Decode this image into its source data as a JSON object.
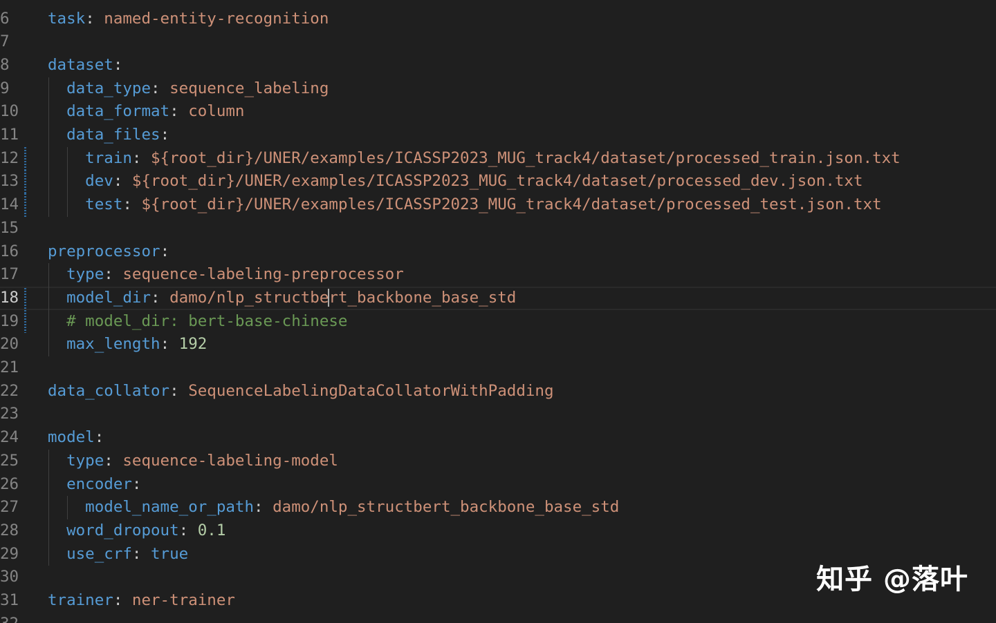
{
  "editor": {
    "language": "yaml",
    "active_line": "18",
    "lines": [
      {
        "num": "6",
        "tokens": [
          {
            "t": "task",
            "c": "k"
          },
          {
            "t": ": ",
            "c": "p"
          },
          {
            "t": "named-entity-recognition",
            "c": "s"
          }
        ]
      },
      {
        "num": "7",
        "tokens": []
      },
      {
        "num": "8",
        "tokens": [
          {
            "t": "dataset",
            "c": "k"
          },
          {
            "t": ":",
            "c": "p"
          }
        ]
      },
      {
        "num": "9",
        "tokens": [
          {
            "t": "  data_type",
            "c": "k"
          },
          {
            "t": ": ",
            "c": "p"
          },
          {
            "t": "sequence_labeling",
            "c": "s"
          }
        ]
      },
      {
        "num": "10",
        "tokens": [
          {
            "t": "  data_format",
            "c": "k"
          },
          {
            "t": ": ",
            "c": "p"
          },
          {
            "t": "column",
            "c": "s"
          }
        ]
      },
      {
        "num": "11",
        "tokens": [
          {
            "t": "  data_files",
            "c": "k"
          },
          {
            "t": ":",
            "c": "p"
          }
        ]
      },
      {
        "num": "12",
        "tokens": [
          {
            "t": "    train",
            "c": "k"
          },
          {
            "t": ": ",
            "c": "p"
          },
          {
            "t": "${root_dir}/UNER/examples/ICASSP2023_MUG_track4/dataset/processed_train.json.txt",
            "c": "s"
          }
        ]
      },
      {
        "num": "13",
        "tokens": [
          {
            "t": "    dev",
            "c": "k"
          },
          {
            "t": ": ",
            "c": "p"
          },
          {
            "t": "${root_dir}/UNER/examples/ICASSP2023_MUG_track4/dataset/processed_dev.json.txt",
            "c": "s"
          }
        ]
      },
      {
        "num": "14",
        "tokens": [
          {
            "t": "    test",
            "c": "k"
          },
          {
            "t": ": ",
            "c": "p"
          },
          {
            "t": "${root_dir}/UNER/examples/ICASSP2023_MUG_track4/dataset/processed_test.json.txt",
            "c": "s"
          }
        ]
      },
      {
        "num": "15",
        "tokens": []
      },
      {
        "num": "16",
        "tokens": [
          {
            "t": "preprocessor",
            "c": "k"
          },
          {
            "t": ":",
            "c": "p"
          }
        ]
      },
      {
        "num": "17",
        "tokens": [
          {
            "t": "  type",
            "c": "k"
          },
          {
            "t": ": ",
            "c": "p"
          },
          {
            "t": "sequence-labeling-preprocessor",
            "c": "s"
          }
        ]
      },
      {
        "num": "18",
        "tokens": [
          {
            "t": "  model_dir",
            "c": "k"
          },
          {
            "t": ": ",
            "c": "p"
          },
          {
            "t": "damo/nlp_structbe",
            "c": "s"
          },
          {
            "t": "",
            "c": "cursor"
          },
          {
            "t": "rt_backbone_base_std",
            "c": "s"
          }
        ]
      },
      {
        "num": "19",
        "tokens": [
          {
            "t": "  # model_dir: bert-base-chinese",
            "c": "c"
          }
        ]
      },
      {
        "num": "20",
        "tokens": [
          {
            "t": "  max_length",
            "c": "k"
          },
          {
            "t": ": ",
            "c": "p"
          },
          {
            "t": "192",
            "c": "n"
          }
        ]
      },
      {
        "num": "21",
        "tokens": []
      },
      {
        "num": "22",
        "tokens": [
          {
            "t": "data_collator",
            "c": "k"
          },
          {
            "t": ": ",
            "c": "p"
          },
          {
            "t": "SequenceLabelingDataCollatorWithPadding",
            "c": "s"
          }
        ]
      },
      {
        "num": "23",
        "tokens": []
      },
      {
        "num": "24",
        "tokens": [
          {
            "t": "model",
            "c": "k"
          },
          {
            "t": ":",
            "c": "p"
          }
        ]
      },
      {
        "num": "25",
        "tokens": [
          {
            "t": "  type",
            "c": "k"
          },
          {
            "t": ": ",
            "c": "p"
          },
          {
            "t": "sequence-labeling-model",
            "c": "s"
          }
        ]
      },
      {
        "num": "26",
        "tokens": [
          {
            "t": "  encoder",
            "c": "k"
          },
          {
            "t": ":",
            "c": "p"
          }
        ]
      },
      {
        "num": "27",
        "tokens": [
          {
            "t": "    model_name_or_path",
            "c": "k"
          },
          {
            "t": ": ",
            "c": "p"
          },
          {
            "t": "damo/nlp_structbert_backbone_base_std",
            "c": "s"
          }
        ]
      },
      {
        "num": "28",
        "tokens": [
          {
            "t": "  word_dropout",
            "c": "k"
          },
          {
            "t": ": ",
            "c": "p"
          },
          {
            "t": "0.1",
            "c": "n"
          }
        ]
      },
      {
        "num": "29",
        "tokens": [
          {
            "t": "  use_crf",
            "c": "k"
          },
          {
            "t": ": ",
            "c": "p"
          },
          {
            "t": "true",
            "c": "b"
          }
        ]
      },
      {
        "num": "30",
        "tokens": []
      },
      {
        "num": "31",
        "tokens": [
          {
            "t": "trainer",
            "c": "k"
          },
          {
            "t": ": ",
            "c": "p"
          },
          {
            "t": "ner-trainer",
            "c": "s"
          }
        ]
      },
      {
        "num": "32",
        "tokens": []
      }
    ],
    "indent_guides": [
      {
        "from": "9",
        "to": "14",
        "level": 1
      },
      {
        "from": "12",
        "to": "14",
        "level": 2
      },
      {
        "from": "17",
        "to": "20",
        "level": 1
      },
      {
        "from": "25",
        "to": "29",
        "level": 1
      },
      {
        "from": "27",
        "to": "27",
        "level": 2
      }
    ],
    "modified_lines": [
      "12",
      "13",
      "14",
      "18",
      "19"
    ]
  },
  "watermark": {
    "text": "知乎 @落叶"
  },
  "colors": {
    "background": "#1f1f1f",
    "key": "#569cd6",
    "string": "#ce9178",
    "number": "#b5cea8",
    "comment": "#6a9955",
    "line_number": "#858585"
  }
}
